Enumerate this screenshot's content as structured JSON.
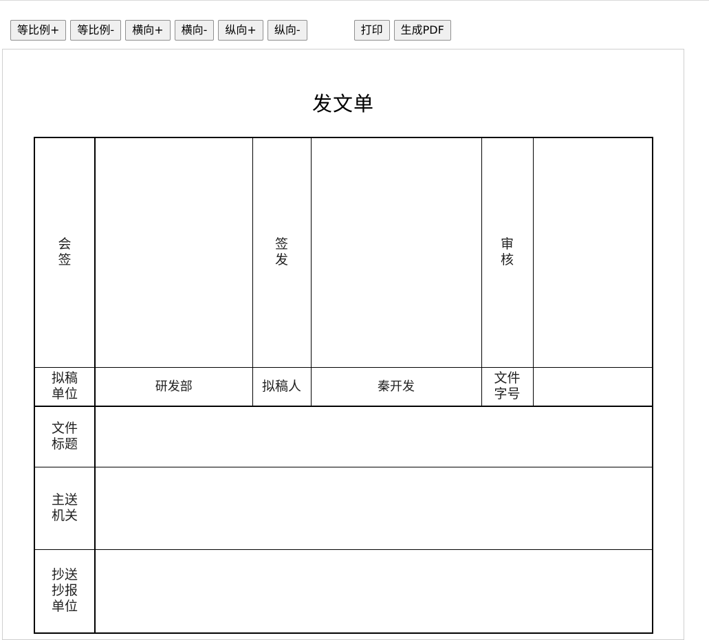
{
  "toolbar": {
    "zoom_in": "等比例+",
    "zoom_out": "等比例-",
    "width_in": "横向+",
    "width_out": "横向-",
    "height_in": "纵向+",
    "height_out": "纵向-",
    "print": "打印",
    "pdf": "生成PDF"
  },
  "document": {
    "title": "发文单",
    "countersign_label": [
      "会",
      "签"
    ],
    "issue_label": [
      "签",
      "发"
    ],
    "review_label": [
      "审",
      "核"
    ],
    "draft_unit_label": [
      "拟稿",
      "单位"
    ],
    "draft_unit_value": "研发部",
    "drafter_label": "拟稿人",
    "drafter_value": "秦开发",
    "file_number_label": [
      "文件",
      "字号"
    ],
    "file_number_value": "",
    "file_title_label": [
      "文件",
      "标题"
    ],
    "file_title_value": "",
    "main_recipient_label": [
      "主送",
      "机关"
    ],
    "main_recipient_value": "",
    "cc_label": [
      "抄送",
      "抄报",
      "单位"
    ],
    "cc_value": ""
  }
}
